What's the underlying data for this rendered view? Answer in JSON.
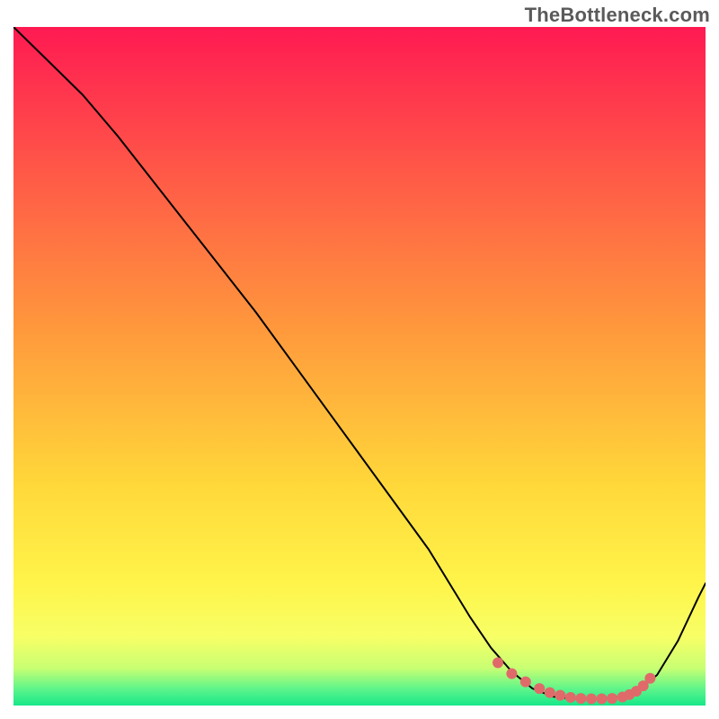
{
  "watermark": "TheBottleneck.com",
  "chart_data": {
    "type": "line",
    "title": "",
    "xlabel": "",
    "ylabel": "",
    "xlim": [
      0,
      100
    ],
    "ylim": [
      0,
      100
    ],
    "grid": false,
    "series": [
      {
        "name": "bottleneck-curve",
        "color": "#000000",
        "stroke_width": 2,
        "x": [
          0,
          5,
          10,
          15,
          20,
          25,
          30,
          35,
          40,
          45,
          50,
          55,
          60,
          63,
          66,
          69,
          72,
          75,
          78,
          81,
          84,
          87,
          90,
          93,
          96,
          99,
          100
        ],
        "y": [
          100,
          95,
          90,
          84,
          77.5,
          71,
          64.5,
          58,
          51,
          44,
          37,
          30,
          23,
          18,
          13,
          8.5,
          5,
          2.5,
          1.3,
          1.0,
          1.0,
          1.2,
          2.0,
          4.5,
          9.5,
          16,
          18
        ]
      },
      {
        "name": "optimal-range-markers",
        "color": "#e06a6a",
        "marker_size": 6,
        "x": [
          70,
          72,
          74,
          76,
          77.5,
          79,
          80.5,
          82,
          83.5,
          85,
          86.5,
          88,
          89,
          90,
          91,
          92
        ],
        "y": [
          6.3,
          4.7,
          3.5,
          2.5,
          1.9,
          1.5,
          1.2,
          1.05,
          1.0,
          1.0,
          1.05,
          1.25,
          1.6,
          2.1,
          2.9,
          4.0
        ]
      }
    ],
    "background_gradient": {
      "type": "vertical",
      "stops": [
        {
          "offset": 0.0,
          "color": "#ff1a52"
        },
        {
          "offset": 0.22,
          "color": "#ff5a47"
        },
        {
          "offset": 0.45,
          "color": "#ff9a3c"
        },
        {
          "offset": 0.68,
          "color": "#ffd93a"
        },
        {
          "offset": 0.82,
          "color": "#fff44a"
        },
        {
          "offset": 0.9,
          "color": "#f7ff66"
        },
        {
          "offset": 0.945,
          "color": "#c8ff73"
        },
        {
          "offset": 0.975,
          "color": "#60f58a"
        },
        {
          "offset": 1.0,
          "color": "#16e789"
        }
      ]
    }
  }
}
